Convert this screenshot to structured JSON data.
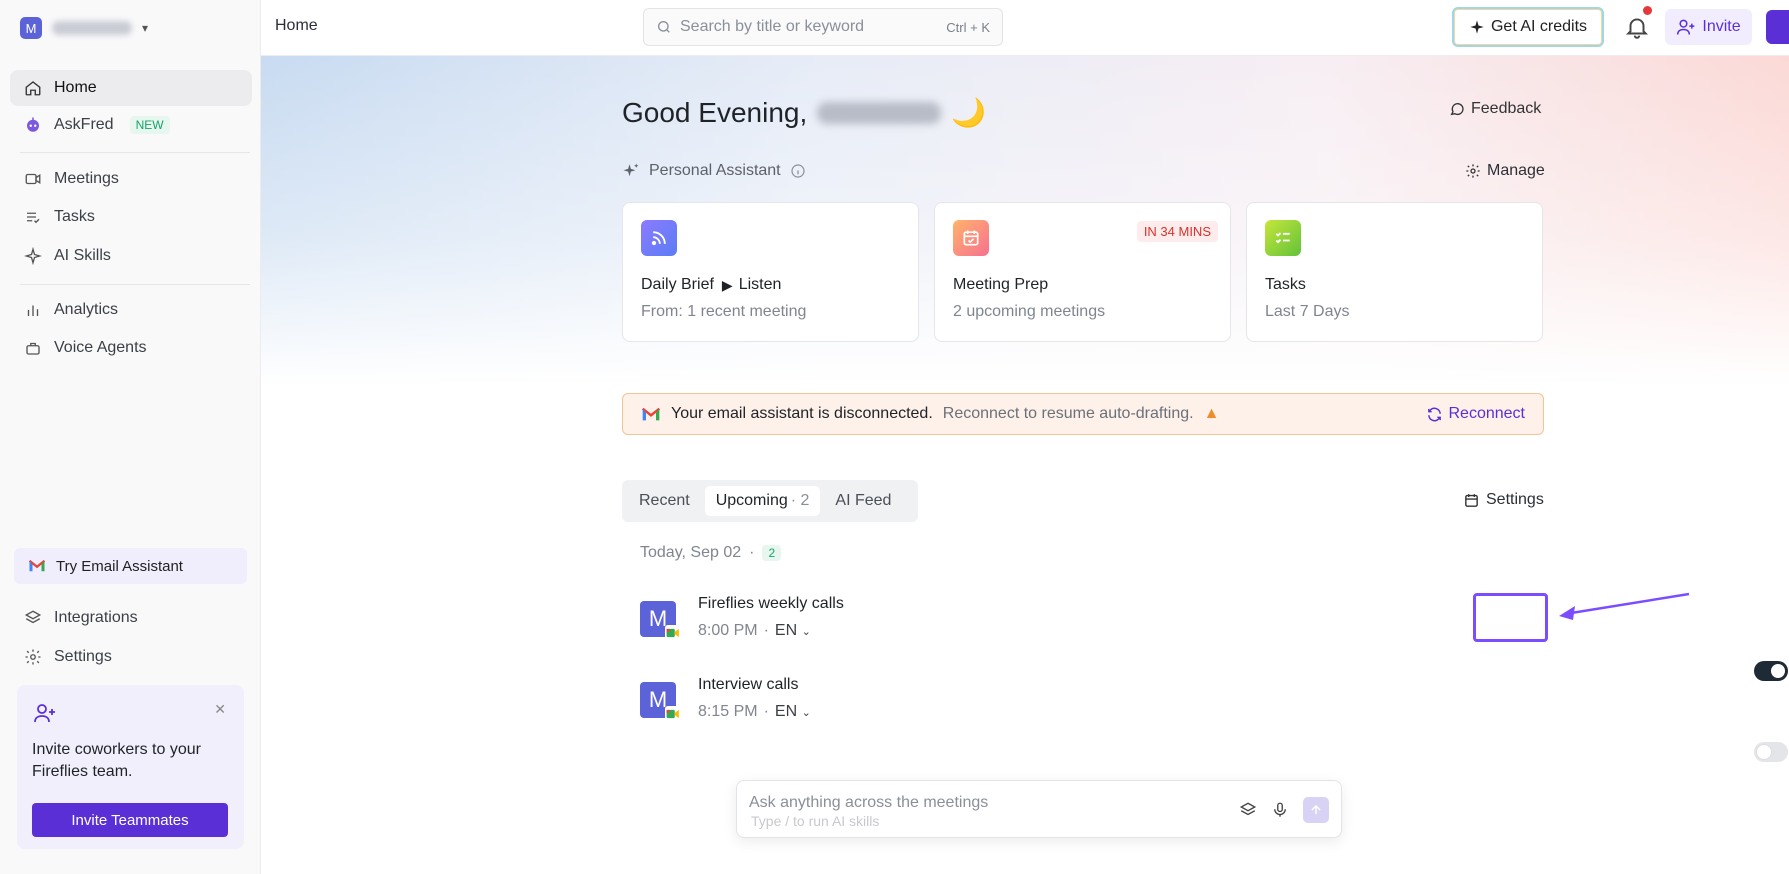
{
  "sidebar": {
    "workspace_initial": "M",
    "nav": [
      {
        "label": "Home",
        "icon": "home-icon"
      },
      {
        "label": "AskFred",
        "icon": "bot-icon",
        "badge": "NEW"
      },
      {
        "label": "Meetings",
        "icon": "video-icon"
      },
      {
        "label": "Tasks",
        "icon": "tasks-icon"
      },
      {
        "label": "AI Skills",
        "icon": "sparkle-icon"
      },
      {
        "label": "Analytics",
        "icon": "analytics-icon"
      },
      {
        "label": "Voice Agents",
        "icon": "voice-agent-icon"
      }
    ],
    "try_email": "Try Email Assistant",
    "integrations": "Integrations",
    "settings": "Settings",
    "invite_card": {
      "text": "Invite coworkers to your Fireflies team.",
      "button": "Invite Teammates"
    }
  },
  "topbar": {
    "breadcrumb": "Home",
    "search_placeholder": "Search by title or keyword",
    "search_shortcut": "Ctrl + K",
    "ai_credits": "Get AI credits",
    "invite": "Invite"
  },
  "main": {
    "greeting": "Good Evening,",
    "greeting_emoji": "🌙",
    "feedback": "Feedback",
    "personal_assistant": "Personal Assistant",
    "manage": "Manage",
    "cards": [
      {
        "title": "Daily Brief",
        "action": "Listen",
        "sub": "From: 1 recent meeting",
        "icon": "rss-icon"
      },
      {
        "title": "Meeting Prep",
        "sub": "2 upcoming meetings",
        "pill": "IN 34 MINS",
        "icon": "calendar-icon"
      },
      {
        "title": "Tasks",
        "sub": "Last 7 Days",
        "icon": "checklist-icon"
      }
    ],
    "alert": {
      "bold": "Your email assistant is disconnected.",
      "muted": "Reconnect to resume auto-drafting.",
      "action": "Reconnect"
    },
    "tabs": [
      {
        "label": "Recent"
      },
      {
        "label": "Upcoming",
        "count": "· 2"
      },
      {
        "label": "AI Feed"
      }
    ],
    "settings": "Settings",
    "date_label": "Today, Sep 02",
    "date_sep": "·",
    "date_count": "2",
    "meetings": [
      {
        "initial": "M",
        "name": "Fireflies weekly calls",
        "time": "8:00 PM",
        "lang": "EN",
        "enabled": true
      },
      {
        "initial": "M",
        "name": "Interview calls",
        "time": "8:15 PM",
        "lang": "EN",
        "enabled": false
      }
    ],
    "ask": {
      "placeholder": "Ask anything across the meetings",
      "hint": "Type / to run AI skills"
    }
  },
  "colors": {
    "accent": "#5b2fd6",
    "avatar": "#5c63d8",
    "highlight": "#7c4dff"
  }
}
